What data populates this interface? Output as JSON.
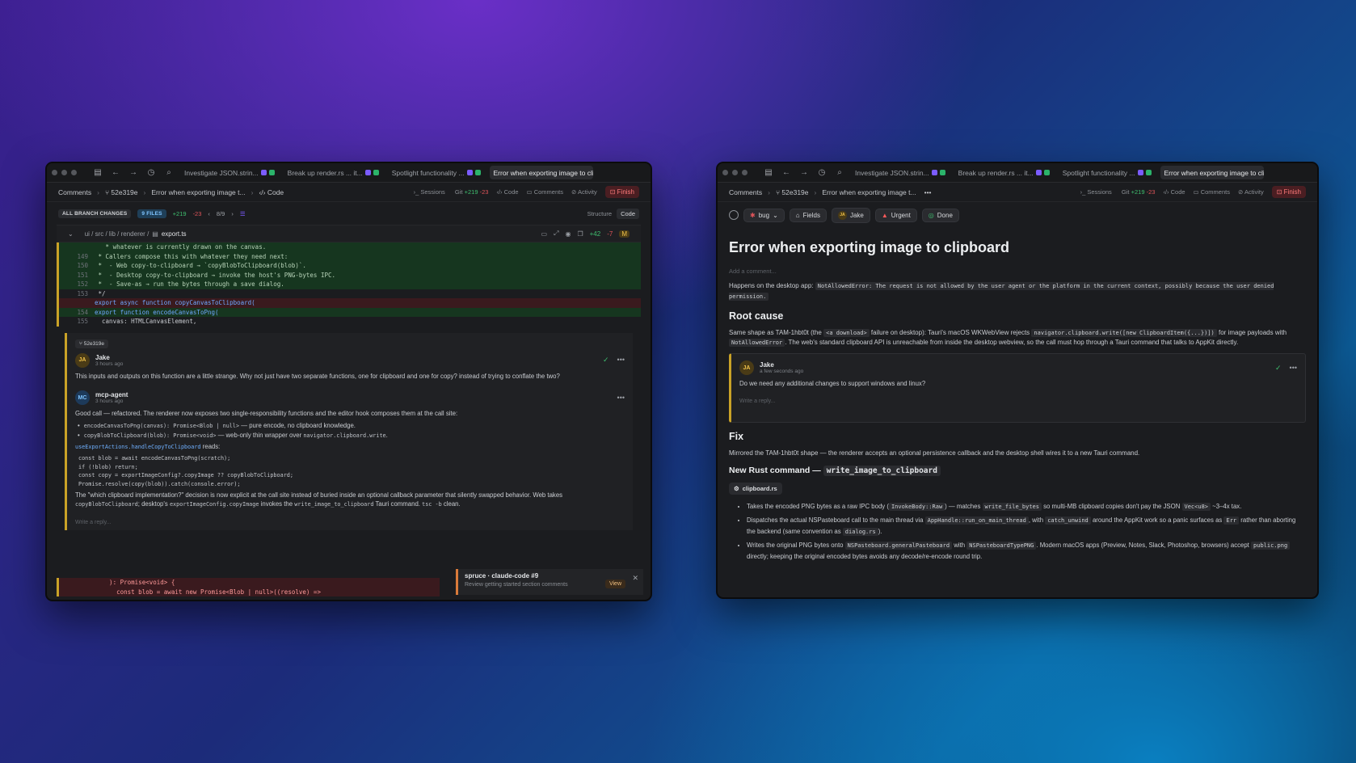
{
  "tabs": [
    {
      "label": "Investigate JSON.strin..."
    },
    {
      "label": "Break up render.rs ... it..."
    },
    {
      "label": "Spotlight functionality ..."
    },
    {
      "label": "Error when exporting image to cli..."
    }
  ],
  "breadcrumbs": {
    "comments": "Comments",
    "commit": "52e319e",
    "issue_left": "Error when exporting image t...",
    "code": "Code",
    "issue_right": "Error when exporting image t..."
  },
  "nav": {
    "sessions": "Sessions",
    "git": "Git",
    "git_add": "+219",
    "git_del": "-23",
    "code": "Code",
    "comments": "Comments",
    "activity": "Activity",
    "finish": "Finish"
  },
  "left": {
    "changes_label": "ALL BRANCH CHANGES",
    "files_label": "9 FILES",
    "add": "+219",
    "del": "-23",
    "pager": "8/9",
    "structure": "Structure",
    "code_toggle": "Code",
    "file_path": "ui / src / lib / renderer /",
    "file_name": "export.ts",
    "file_add": "+42",
    "file_del": "-7",
    "file_badge": "M",
    "code_lines": [
      {
        "ln": "",
        "text": "   * whatever is currently drawn on the canvas.",
        "type": "add"
      },
      {
        "ln": "149",
        "text": " * Callers compose this with whatever they need next:",
        "type": "add"
      },
      {
        "ln": "150",
        "text": " *  - Web copy-to-clipboard → `copyBlobToClipboard(blob)`.",
        "type": "add"
      },
      {
        "ln": "151",
        "text": " *  - Desktop copy-to-clipboard → invoke the host's PNG-bytes IPC.",
        "type": "add"
      },
      {
        "ln": "152",
        "text": " *  - Save-as → run the bytes through a save dialog.",
        "type": "add"
      },
      {
        "ln": "153",
        "text": " */",
        "type": "neutral"
      },
      {
        "ln": "",
        "text": "export async function copyCanvasToClipboard(",
        "type": "del"
      },
      {
        "ln": "154",
        "text": "export function encodeCanvasToPng(",
        "type": "add"
      },
      {
        "ln": "155",
        "text": "  canvas: HTMLCanvasElement,",
        "type": "neutral"
      }
    ],
    "thread": {
      "commit_tag": "52e319e",
      "c1_name": "Jake",
      "c1_time": "3 hours ago",
      "c1_initials": "JA",
      "c1_body": "This inputs and outputs on this function are a little strange. Why not just have two separate functions, one for clipboard and one for copy? instead of trying to conflate the two?",
      "c2_name": "mcp-agent",
      "c2_time": "3 hours ago",
      "c2_initials": "MC",
      "c2_intro": "Good call — refactored. The renderer now exposes two single-responsibility functions and the editor hook composes them at the call site:",
      "b1_code": "encodeCanvasToPng(canvas): Promise<Blob | null>",
      "b1_text": " — pure encode, no clipboard knowledge.",
      "b2_code": "copyBlobToClipboard(blob): Promise<void>",
      "b2_text": " — web-only thin wrapper over ",
      "b2_code2": "navigator.clipboard.write",
      "b2_end": ".",
      "reads_code": "useExportActions.handleCopyToClipboard",
      "reads_text": " reads:",
      "code_block": "const blob = await encodeCanvasToPng(scratch);\nif (!blob) return;\nconst copy = exportImageConfig?.copyImage ?? copyBlobToClipboard;\nPromise.resolve(copy(blob)).catch(console.error);",
      "outro_1": "The \"which clipboard implementation?\" decision is now explicit at the call site instead of buried inside an optional callback parameter that silently swapped behavior. Web takes ",
      "outro_code1": "copyBlobToClipboard",
      "outro_2": "; desktop's ",
      "outro_code2": "exportImageConfig.copyImage",
      "outro_3": " invokes the ",
      "outro_code3": "write_image_to_clipboard",
      "outro_4": " Tauri command. ",
      "outro_code4": "tsc -b",
      "outro_5": " clean.",
      "reply": "Write a reply..."
    },
    "bottom_lines": [
      {
        "text": "    ): Promise<void> {",
        "type": "del"
      },
      {
        "text": "      const blob = await new Promise<Blob | null>((resolve) =>",
        "type": "del"
      }
    ],
    "toast": {
      "title": "spruce · claude-code #9",
      "subtitle": "Review getting started section comments",
      "view": "View"
    }
  },
  "right": {
    "toolbar": {
      "bug": "bug",
      "fields": "Fields",
      "assignee": "Jake",
      "priority": "Urgent",
      "status": "Done"
    },
    "title": "Error when exporting image to clipboard",
    "add_comment": "Add a comment...",
    "p1_text": "Happens on the desktop app: ",
    "p1_code": "NotAllowedError: The request is not allowed by the user agent or the platform in the current context, possibly because the user denied permission.",
    "h_root": "Root cause",
    "root_1": "Same shape as TAM-1hbt0t (the ",
    "root_c1": "<a download>",
    "root_2": " failure on desktop): Tauri's macOS WKWebView rejects ",
    "root_c2": "navigator.clipboard.write([new ClipboardItem({...})])",
    "root_3": " for image payloads with ",
    "root_c3": "NotAllowedError",
    "root_4": ". The web's standard clipboard API is unreachable from inside the desktop webview, so the call must hop through a Tauri command that talks to AppKit directly.",
    "comment": {
      "initials": "JA",
      "name": "Jake",
      "time": "a few seconds ago",
      "body": "Do we need any additional changes to support windows and linux?",
      "reply": "Write a reply..."
    },
    "h_fix": "Fix",
    "fix_text": "Mirrored the TAM-1hbt0t shape — the renderer accepts an optional persistence callback and the desktop shell wires it to a new Tauri command.",
    "h_new_prefix": "New Rust command — ",
    "h_new_code": "write_image_to_clipboard",
    "chip": "clipboard.rs",
    "li1_a": "Takes the encoded PNG bytes as a raw IPC body (",
    "li1_c1": "InvokeBody::Raw",
    "li1_b": ") — matches ",
    "li1_c2": "write_file_bytes",
    "li1_c": " so multi-MB clipboard copies don't pay the JSON ",
    "li1_c3": "Vec<u8>",
    "li1_d": " ~3–4x tax.",
    "li2_a": "Dispatches the actual NSPasteboard call to the main thread via ",
    "li2_c1": "AppHandle::run_on_main_thread",
    "li2_b": ", with ",
    "li2_c2": "catch_unwind",
    "li2_c": " around the AppKit work so a panic surfaces as ",
    "li2_c3": "Err",
    "li2_d": " rather than aborting the backend (same convention as ",
    "li2_c4": "dialog.rs",
    "li2_e": ").",
    "li3_a": "Writes the original PNG bytes onto ",
    "li3_c1": "NSPasteboard.generalPasteboard",
    "li3_b": " with ",
    "li3_c2": "NSPasteboardTypePNG",
    "li3_c": ". Modern macOS apps (Preview, Notes, Slack, Photoshop, browsers) accept ",
    "li3_c3": "public.png",
    "li3_d": " directly; keeping the original encoded bytes avoids any decode/re-encode round trip."
  },
  "colors": {
    "accent_add": "#3fbf6f",
    "accent_del": "#e0545a",
    "thread_border": "#c9a227",
    "finish": "#ff7b7b"
  },
  "icons": [
    "sidebar-icon",
    "back-arrow-icon",
    "forward-arrow-icon",
    "history-icon",
    "search-icon",
    "git-branch-icon",
    "check-icon",
    "more-icon",
    "close-icon",
    "tag-icon",
    "warning-icon",
    "done-circle-icon"
  ]
}
